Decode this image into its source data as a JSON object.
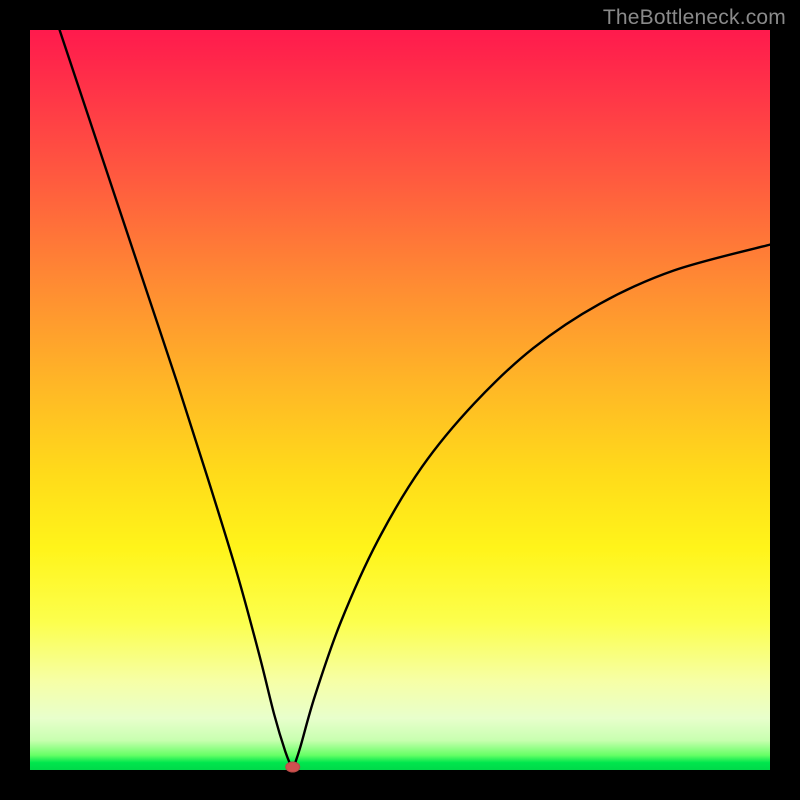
{
  "watermark": "TheBottleneck.com",
  "chart_data": {
    "type": "line",
    "title": "",
    "xlabel": "",
    "ylabel": "",
    "xlim_fraction": [
      0,
      1
    ],
    "ylim_fraction": [
      0,
      1
    ],
    "notch_x_fraction": 0.355,
    "notch_marker": {
      "x_fraction": 0.355,
      "y_fraction": 0.0,
      "color": "#d05050"
    },
    "gradient_stops": [
      {
        "pos": 0.0,
        "color": "#ff1a4d"
      },
      {
        "pos": 0.6,
        "color": "#ffdb1a"
      },
      {
        "pos": 0.93,
        "color": "#e8ffcc"
      },
      {
        "pos": 1.0,
        "color": "#00d94a"
      }
    ],
    "series": [
      {
        "name": "bottleneck-curve",
        "description": "V-shaped curve; y is fraction of plot height from bottom (0=bottom,1=top). Left branch starts at top-left corner (x=0.04,y=1.0), dips to (0.355,0.0). Right branch rises from (0.355,0.0) to (1.0,~0.71).",
        "points": [
          {
            "x": 0.04,
            "y": 1.0
          },
          {
            "x": 0.08,
            "y": 0.88
          },
          {
            "x": 0.12,
            "y": 0.76
          },
          {
            "x": 0.16,
            "y": 0.64
          },
          {
            "x": 0.2,
            "y": 0.52
          },
          {
            "x": 0.24,
            "y": 0.395
          },
          {
            "x": 0.28,
            "y": 0.265
          },
          {
            "x": 0.31,
            "y": 0.155
          },
          {
            "x": 0.33,
            "y": 0.075
          },
          {
            "x": 0.345,
            "y": 0.025
          },
          {
            "x": 0.355,
            "y": 0.0
          },
          {
            "x": 0.365,
            "y": 0.03
          },
          {
            "x": 0.385,
            "y": 0.1
          },
          {
            "x": 0.42,
            "y": 0.2
          },
          {
            "x": 0.47,
            "y": 0.31
          },
          {
            "x": 0.53,
            "y": 0.41
          },
          {
            "x": 0.6,
            "y": 0.495
          },
          {
            "x": 0.68,
            "y": 0.57
          },
          {
            "x": 0.77,
            "y": 0.63
          },
          {
            "x": 0.87,
            "y": 0.675
          },
          {
            "x": 1.0,
            "y": 0.71
          }
        ]
      }
    ]
  }
}
